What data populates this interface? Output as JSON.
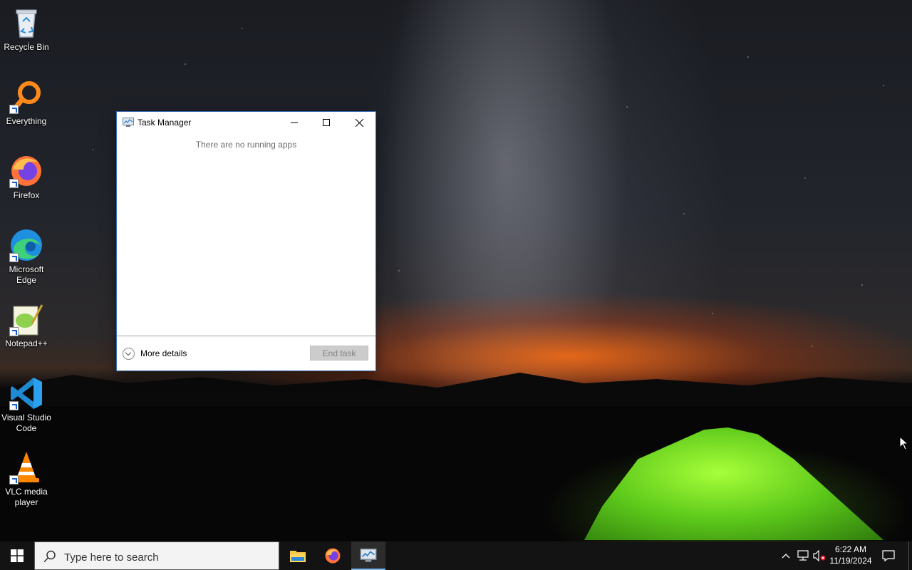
{
  "desktop": {
    "icons": [
      {
        "label": "Recycle Bin",
        "icon": "recycle-bin-icon"
      },
      {
        "label": "Everything",
        "icon": "everything-search-icon"
      },
      {
        "label": "Firefox",
        "icon": "firefox-icon"
      },
      {
        "label": "Microsoft Edge",
        "icon": "edge-icon"
      },
      {
        "label": "Notepad++",
        "icon": "notepadpp-icon"
      },
      {
        "label": "Visual Studio Code",
        "icon": "vscode-icon"
      },
      {
        "label": "VLC media player",
        "icon": "vlc-icon"
      }
    ]
  },
  "task_manager": {
    "title": "Task Manager",
    "empty_message": "There are no running apps",
    "more_details_label": "More details",
    "end_task_label": "End task",
    "end_task_enabled": false
  },
  "taskbar": {
    "search_placeholder": "Type here to search",
    "pinned": [
      {
        "name": "File Explorer",
        "icon": "file-explorer-icon",
        "active": false
      },
      {
        "name": "Firefox",
        "icon": "firefox-icon",
        "active": false
      },
      {
        "name": "Task Manager",
        "icon": "task-manager-icon",
        "active": true
      }
    ],
    "tray_icons": [
      "chevron-up-icon",
      "network-icon",
      "volume-muted-icon"
    ],
    "time": "6:22 AM",
    "date": "11/19/2024"
  },
  "colors": {
    "taskbar_bg": "#131313",
    "active_indicator": "#76b9ed",
    "tent_green": "#7ee02a",
    "horizon_orange": "#ff6e14"
  }
}
